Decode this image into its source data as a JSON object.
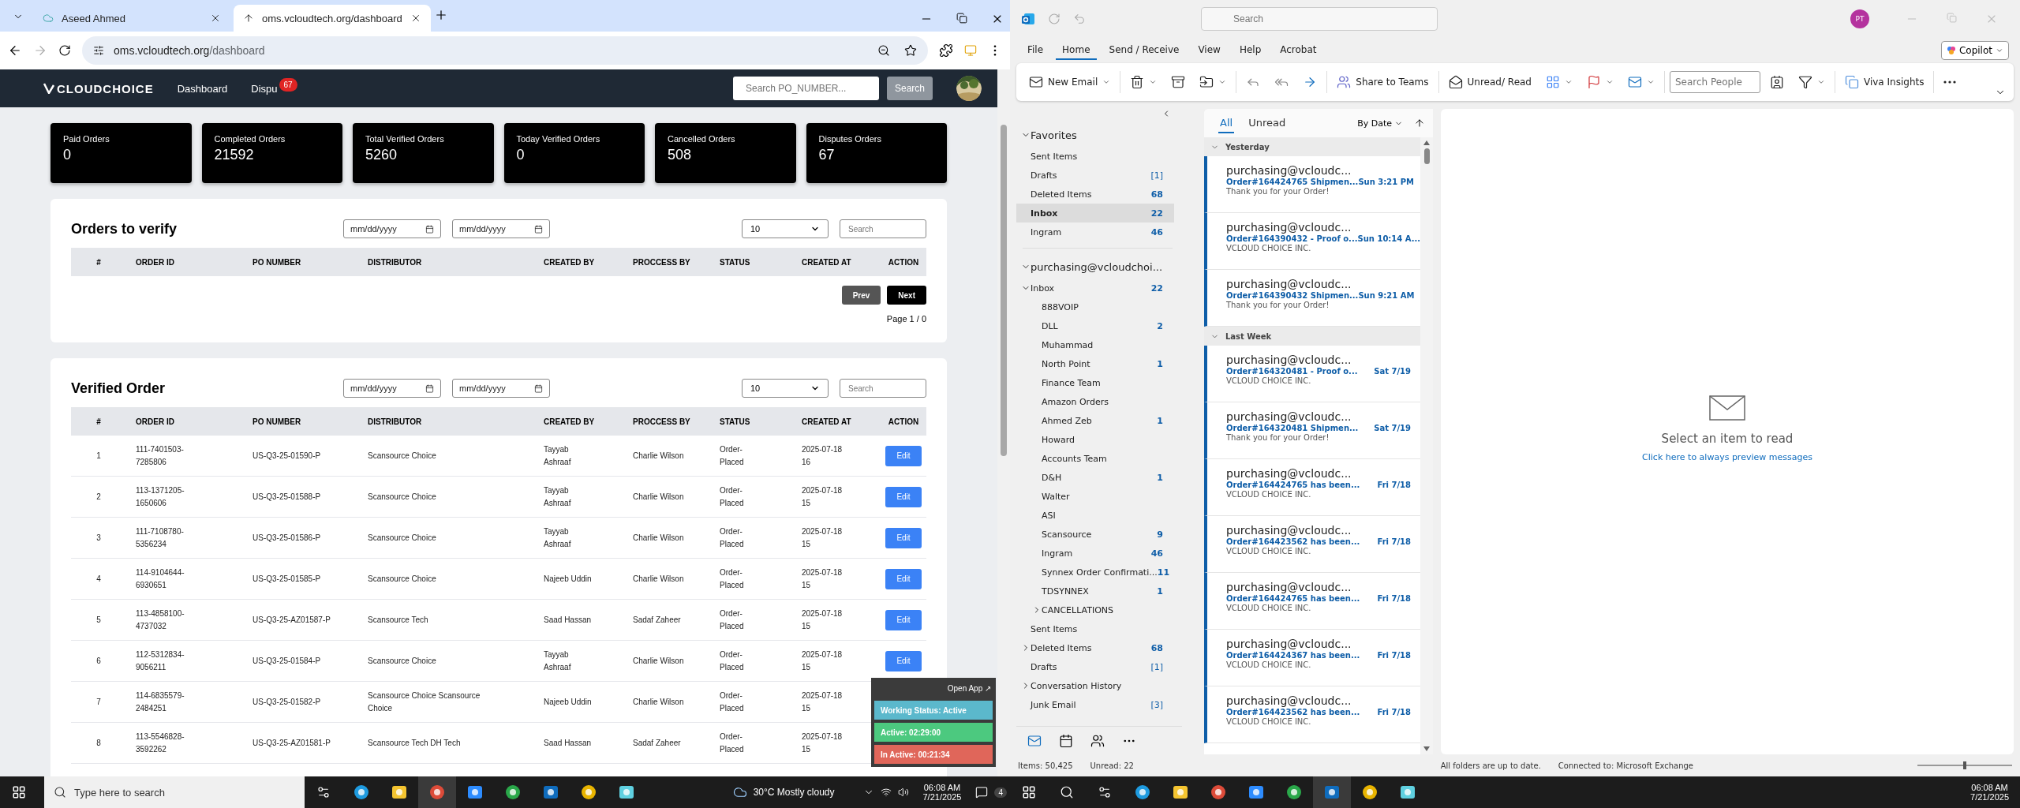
{
  "browser": {
    "tabs": [
      {
        "title": "Aseed Ahmed",
        "selected": false
      },
      {
        "title": "oms.vcloudtech.org/dashboard",
        "selected": true
      }
    ],
    "url_host": "oms.vcloudtech.org",
    "url_path": "/dashboard"
  },
  "app": {
    "brand": "CLOUDCHOICE",
    "nav": [
      {
        "label": "Dashboard"
      },
      {
        "label": "Dispu",
        "badge": "67"
      }
    ],
    "search_placeholder": "Search PO_NUMBER...",
    "search_button": "Search"
  },
  "stats": [
    {
      "label": "Paid Orders",
      "value": "0"
    },
    {
      "label": "Completed Orders",
      "value": "21592"
    },
    {
      "label": "Total Verified Orders",
      "value": "5260"
    },
    {
      "label": "Today Verified Orders",
      "value": "0"
    },
    {
      "label": "Cancelled Orders",
      "value": "508"
    },
    {
      "label": "Disputes Orders",
      "value": "67"
    }
  ],
  "orders_to_verify": {
    "title": "Orders to verify",
    "date_placeholders": [
      "mm/dd/yyyy",
      "mm/dd/yyyy"
    ],
    "page_size": "10",
    "search_placeholder": "Search",
    "columns": [
      "#",
      "ORDER ID",
      "PO NUMBER",
      "DISTRIBUTOR",
      "CREATED BY",
      "PROCCESS BY",
      "STATUS",
      "CREATED AT",
      "ACTION"
    ],
    "prev": "Prev",
    "next": "Next",
    "page": "Page 1 / 0"
  },
  "verified_order": {
    "title": "Verified Order",
    "date_placeholders": [
      "mm/dd/yyyy",
      "mm/dd/yyyy"
    ],
    "page_size": "10",
    "search_placeholder": "Search",
    "columns": [
      "#",
      "ORDER ID",
      "PO NUMBER",
      "DISTRIBUTOR",
      "CREATED BY",
      "PROCCESS BY",
      "STATUS",
      "CREATED AT",
      "ACTION"
    ],
    "rows": [
      {
        "no": "1",
        "order_id": "111-7401503-7285806",
        "po_number": "US-Q3-25-01590-P",
        "distributor": "Scansource Choice",
        "created_by": "Tayyab Ashraaf",
        "process_by": "Charlie Wilson",
        "status": "Order-Placed",
        "created_at": "2025-07-18 16",
        "action": "Edit"
      },
      {
        "no": "2",
        "order_id": "113-1371205-1650606",
        "po_number": "US-Q3-25-01588-P",
        "distributor": "Scansource Choice",
        "created_by": "Tayyab Ashraaf",
        "process_by": "Charlie Wilson",
        "status": "Order-Placed",
        "created_at": "2025-07-18 15",
        "action": "Edit"
      },
      {
        "no": "3",
        "order_id": "111-7108780-5356234",
        "po_number": "US-Q3-25-01586-P",
        "distributor": "Scansource Choice",
        "created_by": "Tayyab Ashraaf",
        "process_by": "Charlie Wilson",
        "status": "Order-Placed",
        "created_at": "2025-07-18 15",
        "action": "Edit"
      },
      {
        "no": "4",
        "order_id": "114-9104644-6930651",
        "po_number": "US-Q3-25-01585-P",
        "distributor": "Scansource Choice",
        "created_by": "Najeeb Uddin",
        "process_by": "Charlie Wilson",
        "status": "Order-Placed",
        "created_at": "2025-07-18 15",
        "action": "Edit"
      },
      {
        "no": "5",
        "order_id": "113-4858100-4737032",
        "po_number": "US-Q3-25-AZ01587-P",
        "distributor": "Scansource Tech",
        "created_by": "Saad Hassan",
        "process_by": "Sadaf Zaheer",
        "status": "Order-Placed",
        "created_at": "2025-07-18 15",
        "action": "Edit"
      },
      {
        "no": "6",
        "order_id": "112-5312834-9056211",
        "po_number": "US-Q3-25-01584-P",
        "distributor": "Scansource Choice",
        "created_by": "Tayyab Ashraaf",
        "process_by": "Charlie Wilson",
        "status": "Order-Placed",
        "created_at": "2025-07-18 15",
        "action": "Edit"
      },
      {
        "no": "7",
        "order_id": "114-6835579-2484251",
        "po_number": "US-Q3-25-01582-P",
        "distributor": "Scansource Choice Scansource Choice",
        "created_by": "Najeeb Uddin",
        "process_by": "Charlie Wilson",
        "status": "Order-Placed",
        "created_at": "2025-07-18 15"
      },
      {
        "no": "8",
        "order_id": "113-5546828-3592262",
        "po_number": "US-Q3-25-AZ01581-P",
        "distributor": "Scansource Tech DH Tech",
        "created_by": "Saad Hassan",
        "process_by": "Sadaf Zaheer",
        "status": "Order-Placed",
        "created_at": "2025-07-18 15"
      }
    ]
  },
  "work_widget": {
    "open_app": "Open App ↗",
    "status": "Working Status: Active",
    "active": "Active: 02:29:00",
    "inactive": "In Active: 00:21:34"
  },
  "outlook": {
    "search_placeholder": "Search",
    "avatar": "PT",
    "menu": [
      {
        "label": "File",
        "selected": false
      },
      {
        "label": "Home",
        "selected": true
      },
      {
        "label": "Send / Receive",
        "selected": false
      },
      {
        "label": "View",
        "selected": false
      },
      {
        "label": "Help",
        "selected": false
      },
      {
        "label": "Acrobat",
        "selected": false
      }
    ],
    "copilot": "Copilot",
    "new_email": "New Email",
    "share_teams": "Share to Teams",
    "unread_read": "Unread/ Read",
    "search_people_placeholder": "Search People",
    "viva": "Viva Insights",
    "folders": [
      {
        "label": "Favorites",
        "expanded": true,
        "heading": true,
        "children": [
          {
            "label": "Sent Items",
            "selected": false
          },
          {
            "label": "Drafts",
            "count": "[1]",
            "selected": false
          },
          {
            "label": "Deleted Items",
            "count": "68",
            "selected": false
          },
          {
            "label": "Inbox",
            "count": "22",
            "selected": true
          },
          {
            "label": "Ingram",
            "count": "46",
            "selected": false
          }
        ]
      },
      {
        "label": "purchasing@vcloudchoi...",
        "expanded": true,
        "heading": true,
        "children": [
          {
            "label": "Inbox",
            "count": "22",
            "selected": false,
            "expanded": true,
            "children": [
              {
                "label": "888VOIP",
                "selected": false
              },
              {
                "label": "DLL",
                "count": "2",
                "selected": false
              },
              {
                "label": "Muhammad",
                "selected": false
              },
              {
                "label": "North Point",
                "count": "1",
                "selected": false
              },
              {
                "label": "Finance Team",
                "selected": false
              },
              {
                "label": "Amazon Orders",
                "selected": false
              },
              {
                "label": "Ahmed Zeb",
                "count": "1",
                "selected": false
              },
              {
                "label": "Howard",
                "selected": false
              },
              {
                "label": "Accounts Team",
                "selected": false
              },
              {
                "label": "D&H",
                "count": "1",
                "selected": false
              },
              {
                "label": "Walter",
                "selected": false
              },
              {
                "label": "ASI",
                "selected": false
              },
              {
                "label": "Scansource",
                "count": "9",
                "selected": false
              },
              {
                "label": "Ingram",
                "count": "46",
                "selected": false
              },
              {
                "label": "Synnex Order Confirmati...",
                "count": "11",
                "selected": false
              },
              {
                "label": "TDSYNNEX",
                "count": "1",
                "selected": false
              },
              {
                "label": "CANCELLATIONS",
                "selected": false,
                "expanded": false
              }
            ]
          },
          {
            "label": "Sent Items",
            "selected": false
          },
          {
            "label": "Deleted Items",
            "count": "68",
            "selected": false,
            "expanded": false
          },
          {
            "label": "Drafts",
            "count": "[1]",
            "selected": false
          },
          {
            "label": "Conversation History",
            "selected": false,
            "expanded": false
          },
          {
            "label": "Junk Email",
            "count": "[3]",
            "selected": false
          }
        ]
      }
    ],
    "filters": [
      {
        "label": "All",
        "selected": true
      },
      {
        "label": "Unread",
        "selected": false
      }
    ],
    "sort": "By Date",
    "groups": [
      {
        "label": "Yesterday",
        "messages": [
          {
            "sender": "purchasing@vcloudc...",
            "subject": "Order#164424765 Shipmen...",
            "time": "Sun 3:21 PM",
            "preview": "Thank you for your Order!",
            "unread": true
          },
          {
            "sender": "purchasing@vcloudc...",
            "subject": "Order#164390432 - Proof o...",
            "time": "Sun 10:14 A...",
            "preview": "VCLOUD CHOICE INC.",
            "unread": true
          },
          {
            "sender": "purchasing@vcloudc...",
            "subject": "Order#164390432 Shipmen...",
            "time": "Sun 9:21 AM",
            "preview": "Thank you for your Order!",
            "unread": true
          }
        ]
      },
      {
        "label": "Last Week",
        "messages": [
          {
            "sender": "purchasing@vcloudc...",
            "subject": "Order#164320481 - Proof o...",
            "time": "Sat 7/19",
            "preview": "VCLOUD CHOICE INC.",
            "unread": true
          },
          {
            "sender": "purchasing@vcloudc...",
            "subject": "Order#164320481 Shipmen...",
            "time": "Sat 7/19",
            "preview": "Thank you for your Order!",
            "unread": true
          },
          {
            "sender": "purchasing@vcloudc...",
            "subject": "Order#164424765 has been...",
            "time": "Fri 7/18",
            "preview": "VCLOUD CHOICE INC.",
            "unread": true
          },
          {
            "sender": "purchasing@vcloudc...",
            "subject": "Order#164423562 has been...",
            "time": "Fri 7/18",
            "preview": "VCLOUD CHOICE INC.",
            "unread": true
          },
          {
            "sender": "purchasing@vcloudc...",
            "subject": "Order#164424765 has been...",
            "time": "Fri 7/18",
            "preview": "VCLOUD CHOICE INC.",
            "unread": true
          },
          {
            "sender": "purchasing@vcloudc...",
            "subject": "Order#164424367 has been...",
            "time": "Fri 7/18",
            "preview": "VCLOUD CHOICE INC.",
            "unread": true
          },
          {
            "sender": "purchasing@vcloudc...",
            "subject": "Order#164423562 has been...",
            "time": "Fri 7/18",
            "preview": "VCLOUD CHOICE INC.",
            "unread": true
          }
        ]
      }
    ],
    "reading_title": "Select an item to read",
    "reading_link": "Click here to always preview messages",
    "zoom_slider": {
      "level": 0.5
    },
    "status": {
      "items": "Items: 50,425",
      "unread": "Unread: 22",
      "sync": "All folders are up to date.",
      "connection": "Connected to: Microsoft Exchange"
    }
  },
  "taskbar_left": {
    "search_placeholder": "Type here to search",
    "weather": "30°C  Mostly cloudy",
    "notifications": "4",
    "time": "06:08 AM",
    "date": "7/21/2025"
  },
  "taskbar_right": {
    "time": "06:08 AM",
    "date": "7/21/2025"
  }
}
